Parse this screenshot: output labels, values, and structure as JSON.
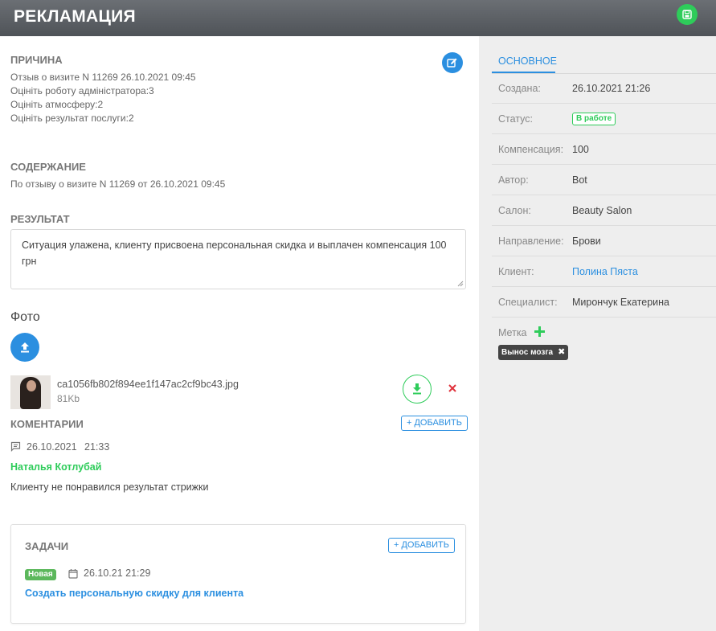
{
  "header": {
    "title": "РЕКЛАМАЦИЯ"
  },
  "icons": {
    "save": "save-icon",
    "edit": "edit-icon",
    "upload": "upload-icon",
    "download": "download-icon",
    "delete": "close-icon",
    "comment": "comment-icon",
    "calendar": "calendar-icon",
    "add": "plus-icon"
  },
  "colors": {
    "accent": "#2b8fe0",
    "success": "#2ecc5a",
    "danger": "#e0323c",
    "header": "#5a5e63",
    "sidebar": "#eeeeee"
  },
  "reason": {
    "title": "ПРИЧИНА",
    "lines": [
      "Отзыв о визите N 11269 26.10.2021 09:45",
      "Оцініть роботу адміністратора:3",
      "Оцініть атмосферу:2",
      "Оцініть результат послуги:2"
    ]
  },
  "content": {
    "title": "СОДЕРЖАНИЕ",
    "text": "По отзыву о визите N 11269 от 26.10.2021 09:45"
  },
  "result": {
    "title": "РЕЗУЛЬТАТ",
    "value": "Ситуация улажена, клиенту присвоена персональная скидка и выплачен компенсация 100 грн"
  },
  "photo": {
    "title": "Фото",
    "file": {
      "name": "ca1056fb802f894ee1f147ac2cf9bc43.jpg",
      "size": "81Kb"
    }
  },
  "comments": {
    "title": "КОМЕНТАРИИ",
    "add_label": "+ ДОБАВИТЬ",
    "items": [
      {
        "date": "26.10.2021",
        "time": "21:33",
        "author": "Наталья Котлубай",
        "text": "Клиенту не понравился результат стрижки"
      }
    ]
  },
  "tasks": {
    "title": "ЗАДАЧИ",
    "add_label": "+ ДОБАВИТЬ",
    "items": [
      {
        "status": "Новая",
        "date": "26.10.21 21:29",
        "title": "Создать персональную скидку для клиента"
      }
    ]
  },
  "sidebar": {
    "tab": "ОСНОВНОЕ",
    "rows": [
      {
        "label": "Создана:",
        "value": "26.10.2021 21:26"
      },
      {
        "label": "Статус:",
        "value": "В работе"
      },
      {
        "label": "Компенсация:",
        "value": "100"
      },
      {
        "label": "Автор:",
        "value": "Bot"
      },
      {
        "label": "Салон:",
        "value": "Beauty Salon"
      },
      {
        "label": "Направление:",
        "value": "Брови"
      },
      {
        "label": "Клиент:",
        "value": "Полина Пяста"
      },
      {
        "label": "Специалист:",
        "value": "Мирончук Екатерина"
      }
    ],
    "tag_label": "Метка",
    "tags": [
      {
        "label": "Вынос мозга"
      }
    ]
  }
}
